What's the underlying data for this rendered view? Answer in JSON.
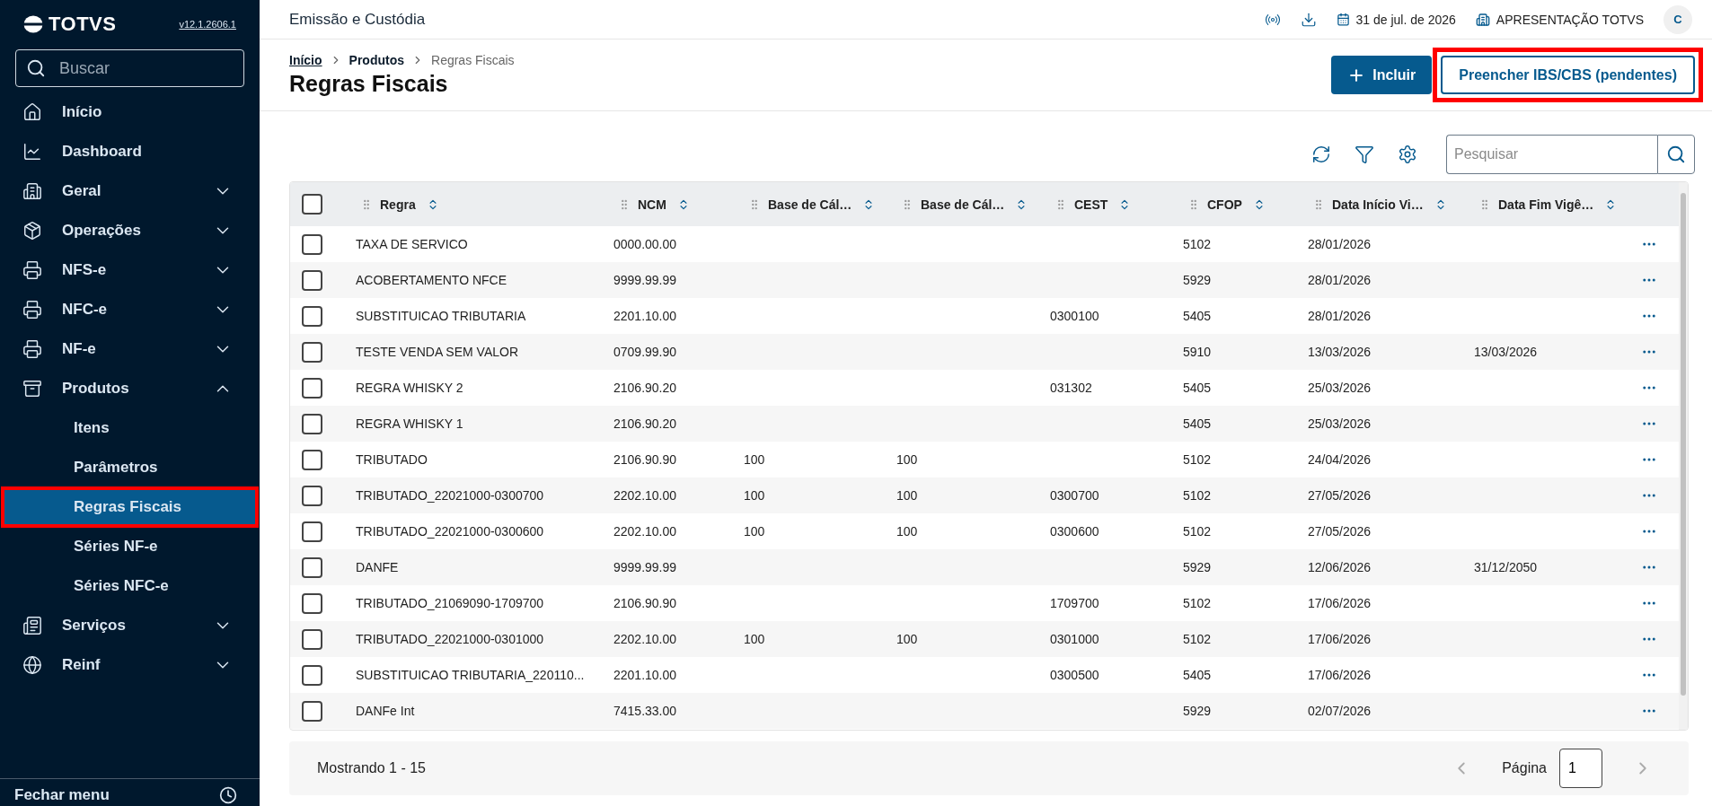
{
  "brand": {
    "logo": "TOTVS",
    "version": "v12.1.2606.1"
  },
  "sidebar": {
    "search": {
      "placeholder": "Buscar"
    },
    "items": [
      {
        "label": "Início",
        "kind": "link"
      },
      {
        "label": "Dashboard",
        "kind": "link"
      },
      {
        "label": "Geral",
        "kind": "group",
        "expanded": false
      },
      {
        "label": "Operações",
        "kind": "group",
        "expanded": false
      },
      {
        "label": "NFS-e",
        "kind": "group",
        "expanded": false
      },
      {
        "label": "NFC-e",
        "kind": "group",
        "expanded": false
      },
      {
        "label": "NF-e",
        "kind": "group",
        "expanded": false
      },
      {
        "label": "Produtos",
        "kind": "group",
        "expanded": true,
        "children": [
          {
            "label": "Itens",
            "selected": false,
            "highlighted": false
          },
          {
            "label": "Parâmetros",
            "selected": false,
            "highlighted": false
          },
          {
            "label": "Regras Fiscais",
            "selected": true,
            "highlighted": true
          },
          {
            "label": "Séries NF-e",
            "selected": false,
            "highlighted": false
          },
          {
            "label": "Séries NFC-e",
            "selected": false,
            "highlighted": false
          }
        ]
      },
      {
        "label": "Serviços",
        "kind": "group",
        "expanded": false
      },
      {
        "label": "Reinf",
        "kind": "group",
        "expanded": false
      }
    ],
    "footer": "Fechar menu"
  },
  "topbar": {
    "module": "Emissão e Custódia",
    "date": "31 de jul. de 2026",
    "company": "APRESENTAÇÃO TOTVS",
    "avatar": "C"
  },
  "page": {
    "breadcrumb": [
      {
        "label": "Início",
        "kind": "link"
      },
      {
        "label": "Produtos",
        "kind": "parent"
      },
      {
        "label": "Regras Fiscais",
        "kind": "current"
      }
    ],
    "title": "Regras Fiscais",
    "actions": [
      {
        "label": "Incluir",
        "kind": "primary",
        "highlighted": false
      },
      {
        "label": "Preencher IBS/CBS (pendentes)",
        "kind": "secondary",
        "highlighted": true
      }
    ]
  },
  "toolbar": {
    "search": {
      "placeholder": "Pesquisar"
    }
  },
  "table": {
    "select_all": false,
    "columns": [
      "Regra",
      "NCM",
      "Base de Cál…",
      "Base de Cál…",
      "CEST",
      "CFOP",
      "Data Início Vi…",
      "Data Fim Vigê…"
    ],
    "rows": [
      {
        "rule": "TAXA DE SERVICO",
        "ncm": "0000.00.00",
        "cfop": "5102",
        "start_date": "28/01/2026",
        "checked": false
      },
      {
        "rule": "ACOBERTAMENTO NFCE",
        "ncm": "9999.99.99",
        "cfop": "5929",
        "start_date": "28/01/2026",
        "checked": false
      },
      {
        "rule": "SUBSTITUICAO TRIBUTARIA",
        "ncm": "2201.10.00",
        "cest": "0300100",
        "cfop": "5405",
        "start_date": "28/01/2026",
        "checked": false
      },
      {
        "rule": "TESTE VENDA SEM VALOR",
        "ncm": "0709.99.90",
        "cfop": "5910",
        "start_date": "13/03/2026",
        "end_date": "13/03/2026",
        "checked": false
      },
      {
        "rule": "REGRA WHISKY 2",
        "ncm": "2106.90.20",
        "cest": "031302",
        "cfop": "5405",
        "start_date": "25/03/2026",
        "checked": false
      },
      {
        "rule": "REGRA WHISKY 1",
        "ncm": "2106.90.20",
        "cfop": "5405",
        "start_date": "25/03/2026",
        "checked": false
      },
      {
        "rule": "TRIBUTADO",
        "ncm": "2106.90.90",
        "base_1": "100",
        "base_2": "100",
        "cfop": "5102",
        "start_date": "24/04/2026",
        "checked": false
      },
      {
        "rule": "TRIBUTADO_22021000-0300700",
        "ncm": "2202.10.00",
        "base_1": "100",
        "base_2": "100",
        "cest": "0300700",
        "cfop": "5102",
        "start_date": "27/05/2026",
        "checked": false
      },
      {
        "rule": "TRIBUTADO_22021000-0300600",
        "ncm": "2202.10.00",
        "base_1": "100",
        "base_2": "100",
        "cest": "0300600",
        "cfop": "5102",
        "start_date": "27/05/2026",
        "checked": false
      },
      {
        "rule": "DANFE",
        "ncm": "9999.99.99",
        "cfop": "5929",
        "start_date": "12/06/2026",
        "end_date": "31/12/2050",
        "checked": false
      },
      {
        "rule": "TRIBUTADO_21069090-1709700",
        "ncm": "2106.90.90",
        "cest": "1709700",
        "cfop": "5102",
        "start_date": "17/06/2026",
        "checked": false
      },
      {
        "rule": "TRIBUTADO_22021000-0301000",
        "ncm": "2202.10.00",
        "base_1": "100",
        "base_2": "100",
        "cest": "0301000",
        "cfop": "5102",
        "start_date": "17/06/2026",
        "checked": false
      },
      {
        "rule": "SUBSTITUICAO TRIBUTARIA_220110...",
        "ncm": "2201.10.00",
        "cest": "0300500",
        "cfop": "5405",
        "start_date": "17/06/2026",
        "checked": false
      },
      {
        "rule": "DANFe Int",
        "ncm": "7415.33.00",
        "cfop": "5929",
        "start_date": "02/07/2026",
        "checked": false
      }
    ]
  },
  "pagination": {
    "summary": "Mostrando 1 - 15",
    "page_label": "Página",
    "page": "1"
  }
}
